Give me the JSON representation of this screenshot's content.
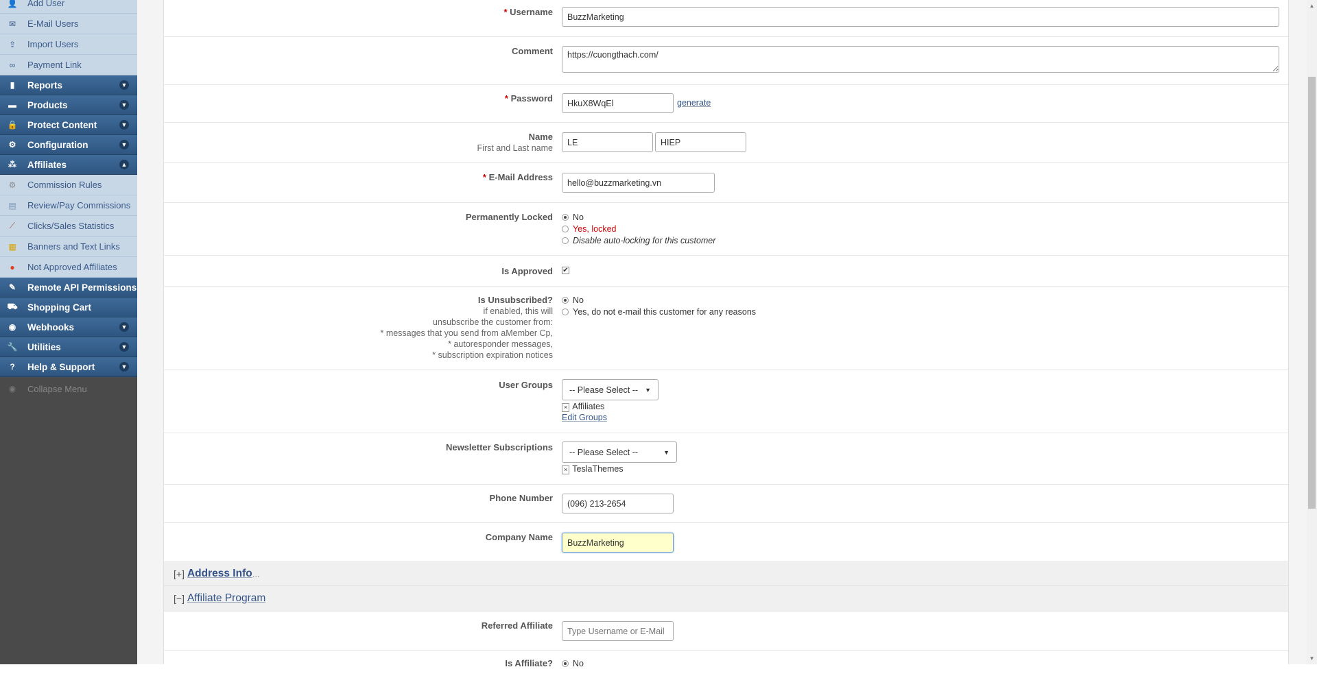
{
  "sidebar": {
    "sub_top": [
      {
        "label": "Add User",
        "icon": "add-user-icon"
      },
      {
        "label": "E-Mail Users",
        "icon": "email-icon"
      },
      {
        "label": "Import Users",
        "icon": "import-icon"
      },
      {
        "label": "Payment Link",
        "icon": "link-icon"
      }
    ],
    "heads_a": [
      {
        "label": "Reports",
        "icon": "chart-icon"
      },
      {
        "label": "Products",
        "icon": "box-icon"
      },
      {
        "label": "Protect Content",
        "icon": "lock-icon"
      },
      {
        "label": "Configuration",
        "icon": "gear-icon"
      },
      {
        "label": "Affiliates",
        "icon": "affiliates-icon"
      }
    ],
    "sub_aff": [
      {
        "label": "Commission Rules",
        "icon": "gear-icon"
      },
      {
        "label": "Review/Pay Commissions",
        "icon": "list-icon"
      },
      {
        "label": "Clicks/Sales Statistics",
        "icon": "stats-icon"
      },
      {
        "label": "Banners and Text Links",
        "icon": "banner-icon"
      },
      {
        "label": "Not Approved Affiliates",
        "icon": "red-dot-icon"
      }
    ],
    "heads_b": [
      {
        "label": "Remote API Permissions",
        "icon": "plug-icon"
      },
      {
        "label": "Shopping Cart",
        "icon": "cart-icon"
      },
      {
        "label": "Webhooks",
        "icon": "webhook-icon"
      },
      {
        "label": "Utilities",
        "icon": "wrench-icon"
      },
      {
        "label": "Help & Support",
        "icon": "help-icon"
      }
    ],
    "collapse_label": "Collapse Menu"
  },
  "form": {
    "username": {
      "label": "Username",
      "value": "BuzzMarketing"
    },
    "comment": {
      "label": "Comment",
      "value": "https://cuongthach.com/"
    },
    "password": {
      "label": "Password",
      "value": "HkuX8WqEl",
      "generate": "generate"
    },
    "name": {
      "label": "Name",
      "sublabel": "First and Last name",
      "first": "LE",
      "last": "HIEP"
    },
    "email": {
      "label": "E-Mail Address",
      "value": "hello@buzzmarketing.vn"
    },
    "locked": {
      "label": "Permanently Locked",
      "opt_no": "No",
      "opt_yes": "Yes, locked",
      "opt_disable": "Disable auto-locking for this customer"
    },
    "approved": {
      "label": "Is Approved",
      "checked": true
    },
    "unsubscribed": {
      "label": "Is Unsubscribed?",
      "help": [
        "if enabled, this will",
        "unsubscribe the customer from:",
        "* messages that you send from aMember Cp,",
        "* autoresponder messages,",
        "* subscription expiration notices"
      ],
      "opt_no": "No",
      "opt_yes": "Yes, do not e-mail this customer for any reasons"
    },
    "user_groups": {
      "label": "User Groups",
      "placeholder": "-- Please Select --",
      "tag": "Affiliates",
      "edit_link": "Edit Groups"
    },
    "newsletter": {
      "label": "Newsletter Subscriptions",
      "placeholder": "-- Please Select --",
      "tag": "TeslaThemes"
    },
    "phone": {
      "label": "Phone Number",
      "value": "(096) 213-2654"
    },
    "company": {
      "label": "Company Name",
      "value": "BuzzMarketing"
    },
    "address_section": {
      "bracket": "[+]",
      "title": "Address Info",
      "dots": "..."
    },
    "affiliate_section": {
      "bracket": "[−]",
      "title": "Affiliate Program"
    },
    "referred": {
      "label": "Referred Affiliate",
      "placeholder": "Type Username or E-Mail"
    },
    "is_affiliate": {
      "label": "Is Affiliate?",
      "opt_no": "No"
    }
  },
  "colors": {
    "sidebar_head": "#2e5580",
    "sidebar_sub": "#c8d7e6",
    "required": "#cc0000",
    "focus_bg": "#ffffcc"
  }
}
